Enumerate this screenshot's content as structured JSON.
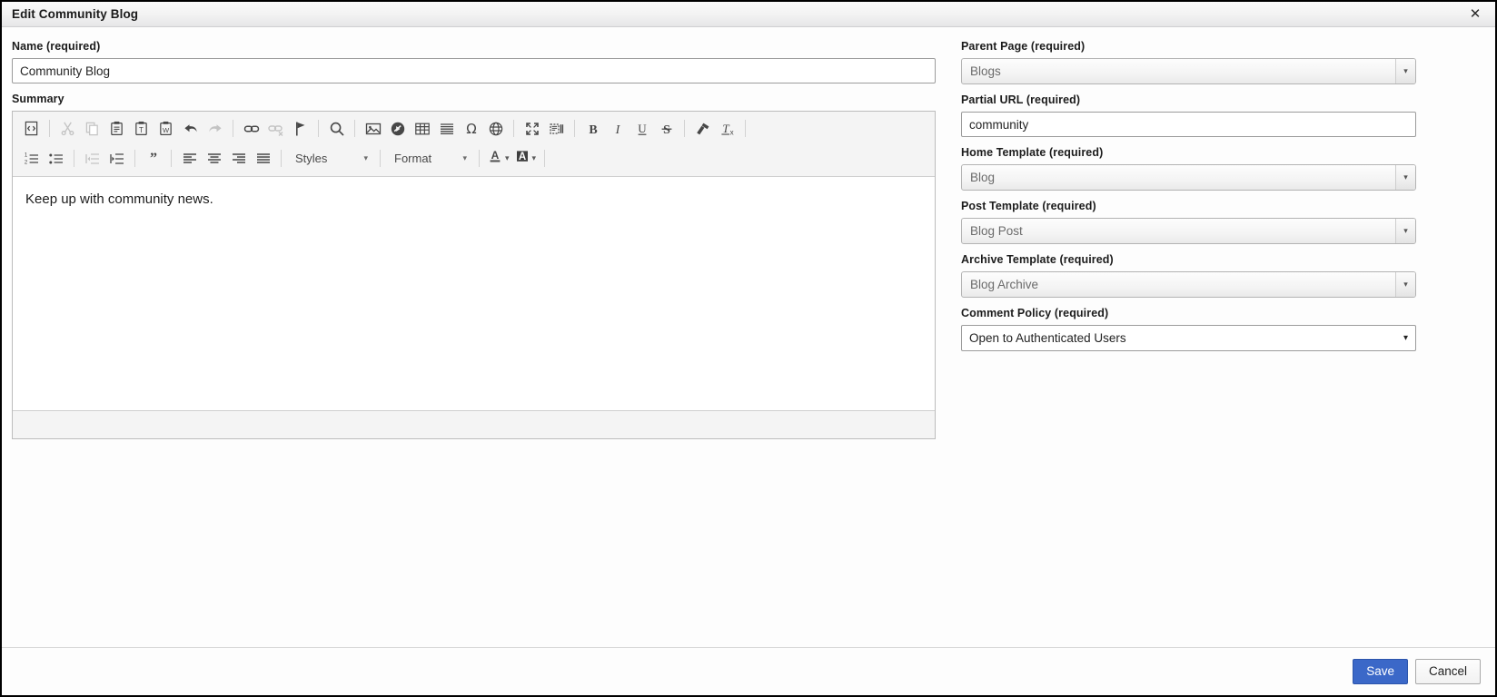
{
  "window": {
    "title": "Edit Community Blog",
    "close_icon": "close-icon",
    "close_glyph": "✕"
  },
  "left": {
    "name": {
      "label": "Name (required)",
      "value": "Community Blog",
      "placeholder": ""
    },
    "summary": {
      "label": "Summary",
      "content": "Keep up with community news."
    }
  },
  "editor": {
    "toolbar_row1": [
      {
        "name": "source-icon",
        "title": "Source",
        "state": "enabled"
      },
      {
        "name": "separator",
        "title": "",
        "state": "sep"
      },
      {
        "name": "cut-icon",
        "title": "Cut",
        "state": "disabled"
      },
      {
        "name": "copy-icon",
        "title": "Copy",
        "state": "disabled"
      },
      {
        "name": "paste-icon",
        "title": "Paste",
        "state": "enabled"
      },
      {
        "name": "paste-as-plain-text-icon",
        "title": "Paste as plain text",
        "state": "enabled"
      },
      {
        "name": "paste-from-word-icon",
        "title": "Paste from Word",
        "state": "enabled"
      },
      {
        "name": "undo-icon",
        "title": "Undo",
        "state": "enabled"
      },
      {
        "name": "redo-icon",
        "title": "Redo",
        "state": "disabled"
      },
      {
        "name": "separator",
        "title": "",
        "state": "sep"
      },
      {
        "name": "link-icon",
        "title": "Link",
        "state": "enabled"
      },
      {
        "name": "unlink-icon",
        "title": "Unlink",
        "state": "disabled"
      },
      {
        "name": "anchor-icon",
        "title": "Anchor",
        "state": "enabled"
      },
      {
        "name": "separator",
        "title": "",
        "state": "sep"
      },
      {
        "name": "find-icon",
        "title": "Find",
        "state": "enabled"
      },
      {
        "name": "separator",
        "title": "",
        "state": "sep"
      },
      {
        "name": "image-icon",
        "title": "Image",
        "state": "enabled"
      },
      {
        "name": "flash-icon",
        "title": "Flash",
        "state": "enabled"
      },
      {
        "name": "table-icon",
        "title": "Table",
        "state": "enabled"
      },
      {
        "name": "horizontal-rule-icon",
        "title": "Horizontal line",
        "state": "enabled"
      },
      {
        "name": "special-character-icon",
        "title": "Insert special character",
        "state": "enabled"
      },
      {
        "name": "iframe-icon",
        "title": "IFrame",
        "state": "enabled"
      },
      {
        "name": "separator",
        "title": "",
        "state": "sep"
      },
      {
        "name": "maximize-icon",
        "title": "Maximize",
        "state": "enabled"
      },
      {
        "name": "show-blocks-icon",
        "title": "Show blocks",
        "state": "enabled"
      },
      {
        "name": "separator",
        "title": "",
        "state": "sep"
      },
      {
        "name": "bold-icon",
        "title": "Bold",
        "state": "enabled"
      },
      {
        "name": "italic-icon",
        "title": "Italic",
        "state": "enabled"
      },
      {
        "name": "underline-icon",
        "title": "Underline",
        "state": "enabled"
      },
      {
        "name": "strikethrough-icon",
        "title": "Strikethrough",
        "state": "enabled"
      },
      {
        "name": "separator",
        "title": "",
        "state": "sep"
      },
      {
        "name": "copy-formatting-icon",
        "title": "Copy formatting",
        "state": "enabled"
      },
      {
        "name": "remove-format-icon",
        "title": "Remove format",
        "state": "enabled"
      },
      {
        "name": "separator",
        "title": "",
        "state": "sep"
      }
    ],
    "toolbar_row2": [
      {
        "name": "numbered-list-icon",
        "title": "Insert/Remove Numbered List",
        "state": "enabled"
      },
      {
        "name": "bulleted-list-icon",
        "title": "Insert/Remove Bulleted List",
        "state": "enabled"
      },
      {
        "name": "separator",
        "title": "",
        "state": "sep"
      },
      {
        "name": "decrease-indent-icon",
        "title": "Decrease Indent",
        "state": "disabled"
      },
      {
        "name": "increase-indent-icon",
        "title": "Increase Indent",
        "state": "enabled"
      },
      {
        "name": "separator",
        "title": "",
        "state": "sep"
      },
      {
        "name": "blockquote-icon",
        "title": "Block Quote",
        "state": "enabled"
      },
      {
        "name": "separator",
        "title": "",
        "state": "sep"
      },
      {
        "name": "align-left-icon",
        "title": "Align Left",
        "state": "enabled"
      },
      {
        "name": "align-center-icon",
        "title": "Center",
        "state": "enabled"
      },
      {
        "name": "align-right-icon",
        "title": "Align Right",
        "state": "enabled"
      },
      {
        "name": "justify-icon",
        "title": "Justify",
        "state": "enabled"
      },
      {
        "name": "separator",
        "title": "",
        "state": "sep"
      }
    ],
    "styles_combo": {
      "label": "Styles",
      "caret": "▾"
    },
    "format_combo": {
      "label": "Format",
      "caret": "▾"
    },
    "text_color": {
      "name": "text-color-icon",
      "caret": "▾"
    },
    "bg_color": {
      "name": "background-color-icon",
      "caret": "▾"
    }
  },
  "right": {
    "parent_page": {
      "label": "Parent Page (required)",
      "value": "Blogs",
      "disabled": true,
      "arrow": "▾"
    },
    "partial_url": {
      "label": "Partial URL (required)",
      "value": "community",
      "placeholder": ""
    },
    "home_template": {
      "label": "Home Template (required)",
      "value": "Blog",
      "disabled": true,
      "arrow": "▾"
    },
    "post_template": {
      "label": "Post Template (required)",
      "value": "Blog Post",
      "disabled": true,
      "arrow": "▾"
    },
    "archive_template": {
      "label": "Archive Template (required)",
      "value": "Blog Archive",
      "disabled": true,
      "arrow": "▾"
    },
    "comment_policy": {
      "label": "Comment Policy (required)",
      "value": "Open to Authenticated Users",
      "options": [
        "Open to Authenticated Users"
      ],
      "arrow": "▾"
    }
  },
  "footer": {
    "save_label": "Save",
    "cancel_label": "Cancel"
  },
  "colors": {
    "accent": "#3b68c8",
    "titlebar": "#f1f1f2",
    "toolbar": "#f4f4f4",
    "border": "#bcbcbc"
  }
}
